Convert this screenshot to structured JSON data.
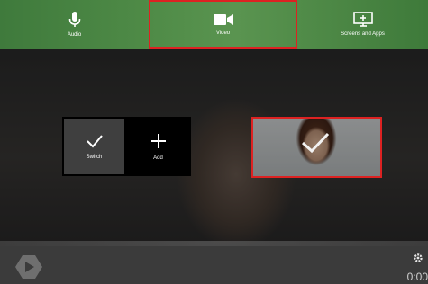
{
  "toolbar": {
    "items": [
      {
        "label": "Audio",
        "icon": "microphone-icon"
      },
      {
        "label": "Video",
        "icon": "video-camera-icon",
        "selected": true
      },
      {
        "label": "Screens and Apps",
        "icon": "screen-share-icon"
      }
    ]
  },
  "actions": {
    "switch_label": "Switch",
    "add_label": "Add"
  },
  "player": {
    "time": "0:00"
  },
  "colors": {
    "toolbar_green": "#4f8b47",
    "selection_red": "#dd2222"
  }
}
